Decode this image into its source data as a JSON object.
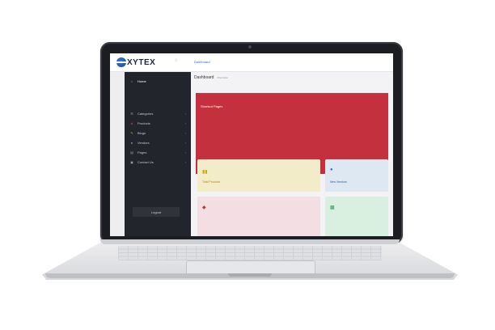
{
  "app": {
    "brand": "XYTEX",
    "breadcrumb_link": "Dashboard",
    "page_title": "Dashboard",
    "sub_breadcrumb": "/Overview"
  },
  "sidebar": {
    "section_label": "",
    "items": [
      {
        "label": "Home",
        "icon": "home-icon",
        "active": true
      },
      {
        "label": "Categories",
        "icon": "list-icon"
      },
      {
        "label": "Products",
        "icon": "box-icon"
      },
      {
        "label": "Blogs",
        "icon": "blog-icon"
      },
      {
        "label": "Vendors",
        "icon": "vendor-icon"
      },
      {
        "label": "Pages",
        "icon": "pages-icon"
      },
      {
        "label": "Contact Us",
        "icon": "contact-icon"
      }
    ],
    "logout_label": "Logout"
  },
  "hero": {
    "title": "Shortcut Pages",
    "color": "#c4303d"
  },
  "cards": [
    {
      "label": "Total Products",
      "icon": "bar-chart-icon",
      "color": "#d4a21a",
      "bg": "#f3ecc8"
    },
    {
      "label": "New Vendors",
      "icon": "user-icon",
      "color": "#2b74c9",
      "bg": "#dde8f2"
    },
    {
      "label": "",
      "icon": "diamond-icon",
      "color": "#c4303d",
      "bg": "#f3dfe3"
    },
    {
      "label": "",
      "icon": "inbox-icon",
      "color": "#2e9e57",
      "bg": "#d9efe0"
    }
  ]
}
